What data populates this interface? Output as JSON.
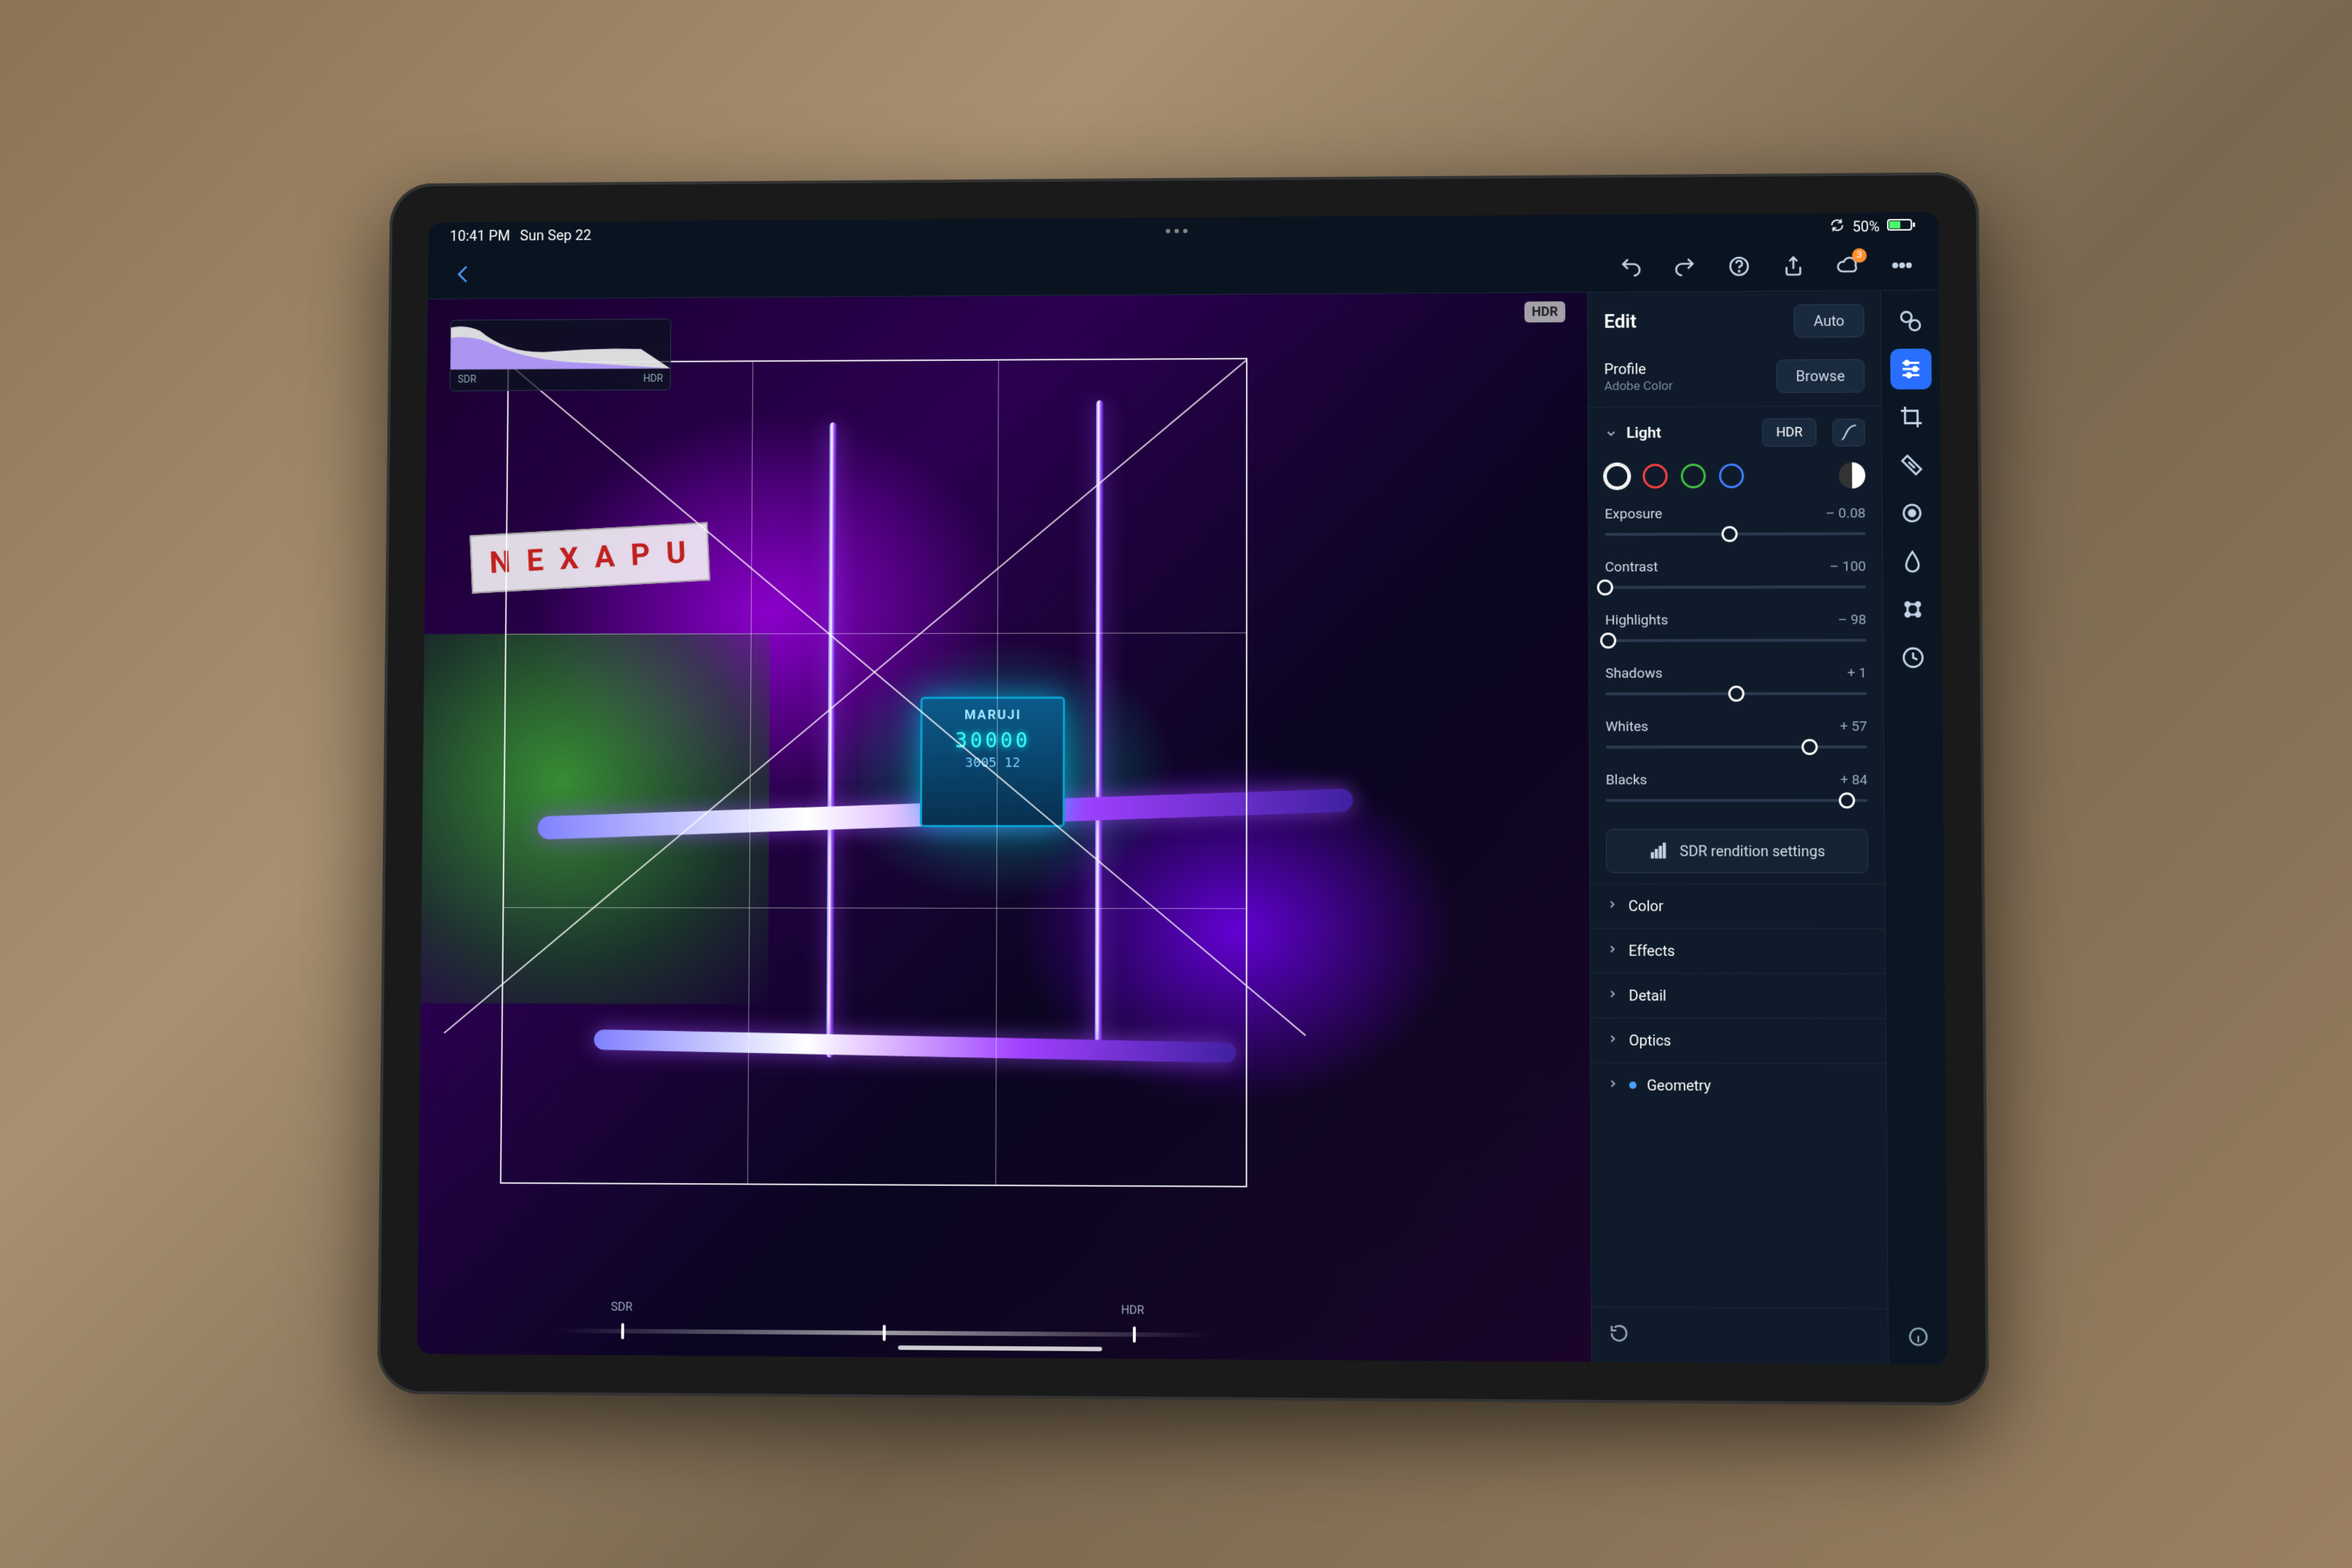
{
  "status": {
    "time": "10:41 PM",
    "date": "Sun Sep 22",
    "battery_pct": "50%",
    "battery_icon": "battery-half"
  },
  "toolbar": {
    "back": "‹",
    "cloud_badge": "3"
  },
  "canvas": {
    "hdr_badge": "HDR",
    "histo_left": "SDR",
    "histo_right": "HDR",
    "slider_left": "SDR",
    "slider_right": "HDR",
    "sign_text": "N E X A P U",
    "meter_brand": "MARUJI",
    "meter_main": "30000",
    "meter_sub": "3005  12"
  },
  "edit": {
    "title": "Edit",
    "auto": "Auto",
    "profile_label": "Profile",
    "profile_value": "Adobe Color",
    "browse": "Browse",
    "light": {
      "title": "Light",
      "hdr": "HDR",
      "sliders": [
        {
          "label": "Exposure",
          "value": "– 0.08",
          "pos": 48
        },
        {
          "label": "Contrast",
          "value": "– 100",
          "pos": 0
        },
        {
          "label": "Highlights",
          "value": "– 98",
          "pos": 1
        },
        {
          "label": "Shadows",
          "value": "+ 1",
          "pos": 50
        },
        {
          "label": "Whites",
          "value": "+ 57",
          "pos": 78
        },
        {
          "label": "Blacks",
          "value": "+ 84",
          "pos": 92
        }
      ],
      "sdr_settings": "SDR rendition settings"
    },
    "sections": [
      {
        "title": "Color",
        "dot": false
      },
      {
        "title": "Effects",
        "dot": false
      },
      {
        "title": "Detail",
        "dot": false
      },
      {
        "title": "Optics",
        "dot": false
      },
      {
        "title": "Geometry",
        "dot": true
      }
    ]
  },
  "rail": {
    "tools": [
      "presets",
      "adjust",
      "crop",
      "healing",
      "masking",
      "brush",
      "water",
      "effects",
      "versions"
    ]
  }
}
